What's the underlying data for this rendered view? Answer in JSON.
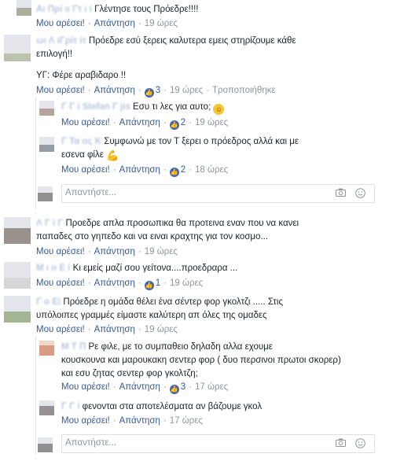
{
  "common": {
    "like_label": "Μου αρέσει!",
    "reply_label": "Απάντηση",
    "dot": "·",
    "like_symbol": "👍",
    "reply_placeholder": "Απαντήστε...",
    "camera_icon": "camera-icon",
    "smiley_icon": "smiley-icon"
  },
  "comments": [
    {
      "author": "Αι Πρί ιι Γτ ι ί",
      "text": "Γλέντησε τους Πρόεδρε!!!!",
      "time": "19 ώρες"
    },
    {
      "author": "ωι Λ ιΓρίτ ίτ",
      "text_line1": "Πρόεδρε εσύ ξερεις καλυτερα εμεις στηρίζουμε κάθε",
      "text_line2": "επιλογή!!",
      "text_line3": "ΥΓ: Φέρε αραβιδαρο !!",
      "likes": "3",
      "time": "19 ώρες",
      "edited": "Τροποποιήθηκε",
      "replies": [
        {
          "author": "Γ Γ ί Stefan Γ jis",
          "text": "Εσυ τι λες για αυτο;",
          "likes": "2",
          "time": "19 ώρες"
        },
        {
          "author": "Γ Τα ος Κ",
          "text_line1": "Συμφωνώ με τον Τ ξερει ο πρόεδρος αλλά και με",
          "text_line2": "εσενα φίλε",
          "likes": "2",
          "time": "18 ώρες"
        }
      ]
    },
    {
      "author": "Λ Γ ί Γ",
      "text_line1": "Προεδρε απλα προσωπικα θα προτεινα εναν που να κανει",
      "text_line2": "παπαδες στο γηπεδο και να ειναι κραχτης για τον κοσμο...",
      "time": "19 ώρες"
    },
    {
      "author": "Μ ι ο Ε ί",
      "text": "Κι εμείς μαζί σου γείτονα....προεδραρα ...",
      "likes": "1",
      "time": "19 ώρες"
    },
    {
      "author": "Γ ο Εί",
      "text_line1": "Πρόεδρε η ομάδα θέλει ένα σέντερ φορ γκολτζι ..... Στις",
      "text_line2": "υπόλοιπες γραμμές είμαστε καλύτερη απ όλες της ομαδες",
      "time": "19 ώρες",
      "replies": [
        {
          "author": "Μ Τ Π",
          "text_line1": "Ρε φιλε, με το συμπαθειο δηλαδη αλλα εχουμε",
          "text_line2": "κουσκουνα και μαρουκακη σεντερ φορ ( δυο περσινοι πρωτοι σκορερ)",
          "text_line3": "και εσυ ζητας σεντερ φορ γκολτζη;",
          "likes": "3",
          "time": "17 ώρες"
        },
        {
          "author": "Γ Γ ί",
          "text": "φενονται στα αποτελέσματα αν βάζουμε γκολ",
          "time": "17 ώρες"
        }
      ]
    }
  ]
}
